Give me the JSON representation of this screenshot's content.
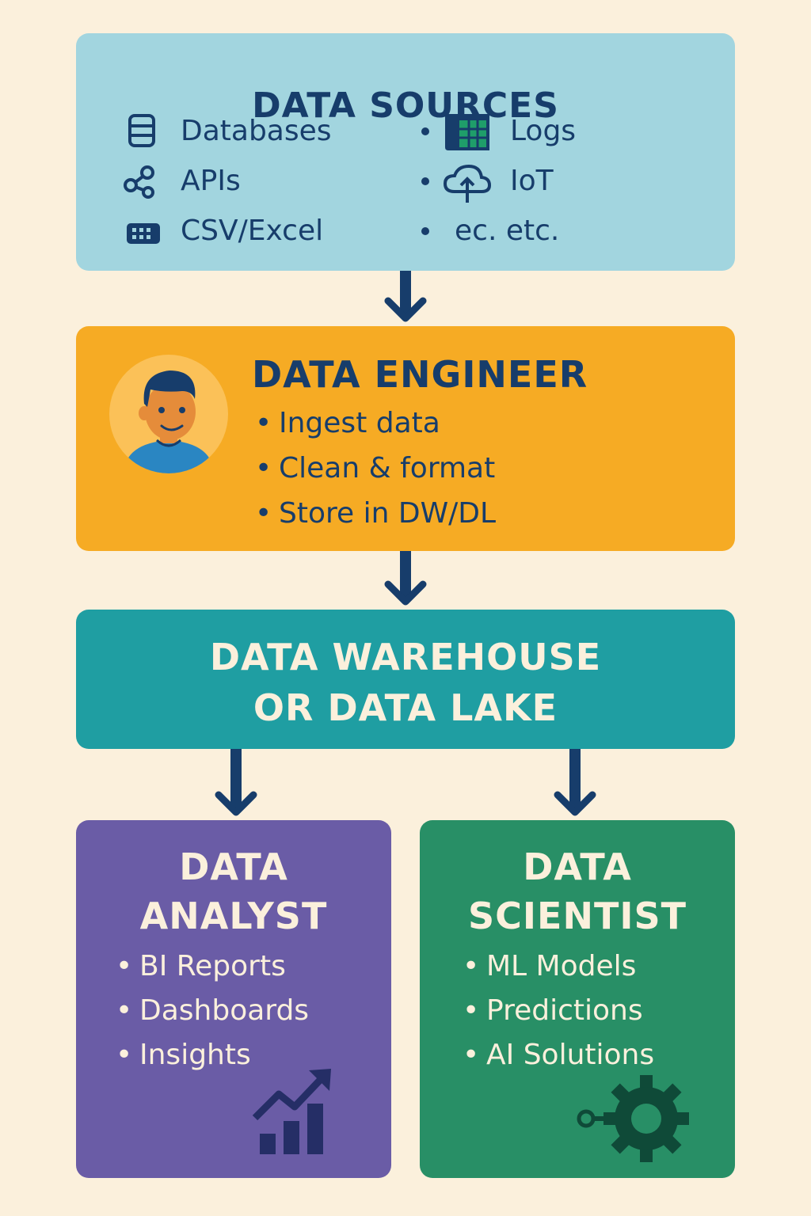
{
  "colors": {
    "background": "#fbf0dc",
    "sources_box": "#a2d5df",
    "engineer_box": "#f6ab24",
    "warehouse_box": "#1f9ea2",
    "analyst_box": "#6a5ca6",
    "scientist_box": "#288f66",
    "dark_navy": "#173d6b",
    "arrow": "#173d6b"
  },
  "sources": {
    "title": "DATA SOURCES",
    "items": [
      {
        "label": "Databases",
        "icon": "database-icon"
      },
      {
        "label": "APIs",
        "icon": "share-nodes-icon"
      },
      {
        "label": "CSV/Excel",
        "icon": "keyboard-grid-icon"
      },
      {
        "label": "Logs",
        "icon": "spreadsheet-icon"
      },
      {
        "label": "IoT",
        "icon": "cloud-upload-icon"
      },
      {
        "label": "ec.  etc.",
        "icon": ""
      }
    ]
  },
  "engineer": {
    "title": "DATA ENGINEER",
    "avatar_icon": "person-avatar-icon",
    "tasks": [
      "Ingest data",
      "Clean & format",
      "Store in DW/DL"
    ]
  },
  "warehouse": {
    "title_line1": "DATA WAREHOUSE",
    "title_line2": "OR DATA LAKE"
  },
  "analyst": {
    "title_line1": "DATA",
    "title_line2": "ANALYST",
    "tasks": [
      "BI Reports",
      "Dashboards",
      "Insights"
    ],
    "icon": "bar-chart-trend-icon"
  },
  "scientist": {
    "title_line1": "DATA",
    "title_line2": "SCIENTIST",
    "tasks": [
      "ML Models",
      "Predictions",
      "AI Solutions"
    ],
    "icon": "gear-icon"
  }
}
